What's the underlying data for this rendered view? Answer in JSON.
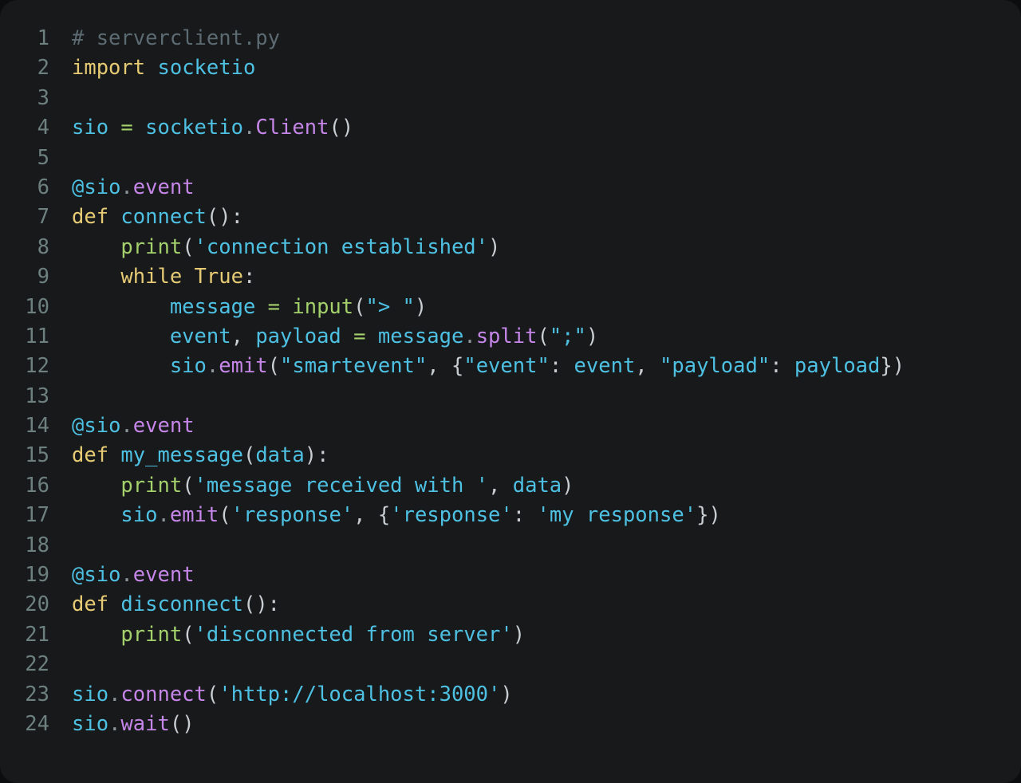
{
  "editor": {
    "filename": "serverclient.py",
    "language": "python",
    "theme": "dark",
    "background_color": "#17191b",
    "page_background_color": "#0b0d0e",
    "gutter_color": "#6d807e",
    "default_text_color": "#d6dadd",
    "first_line_number": 1,
    "last_line_number": 24,
    "total_lines": 24
  },
  "palette": {
    "comment": "#5c6a72",
    "keyword": "#e6cb74",
    "identifier": "#4ec1e3",
    "string": "#4ec1e3",
    "function": "#a4d16b",
    "attribute": "#c586e8",
    "class": "#c586e8",
    "operator": "#a4d16b",
    "punctuation": "#c9ced2"
  },
  "code": {
    "lines": [
      {
        "n": "1",
        "text": "# serverclient.py"
      },
      {
        "n": "2",
        "text": "import socketio"
      },
      {
        "n": "3",
        "text": ""
      },
      {
        "n": "4",
        "text": "sio = socketio.Client()"
      },
      {
        "n": "5",
        "text": ""
      },
      {
        "n": "6",
        "text": "@sio.event"
      },
      {
        "n": "7",
        "text": "def connect():"
      },
      {
        "n": "8",
        "text": "    print('connection established')"
      },
      {
        "n": "9",
        "text": "    while True:"
      },
      {
        "n": "10",
        "text": "        message = input(\"> \")"
      },
      {
        "n": "11",
        "text": "        event, payload = message.split(\";\")"
      },
      {
        "n": "12",
        "text": "        sio.emit(\"smartevent\", {\"event\": event, \"payload\": payload})"
      },
      {
        "n": "13",
        "text": ""
      },
      {
        "n": "14",
        "text": "@sio.event"
      },
      {
        "n": "15",
        "text": "def my_message(data):"
      },
      {
        "n": "16",
        "text": "    print('message received with ', data)"
      },
      {
        "n": "17",
        "text": "    sio.emit('response', {'response': 'my response'})"
      },
      {
        "n": "18",
        "text": ""
      },
      {
        "n": "19",
        "text": "@sio.event"
      },
      {
        "n": "20",
        "text": "def disconnect():"
      },
      {
        "n": "21",
        "text": "    print('disconnected from server')"
      },
      {
        "n": "22",
        "text": ""
      },
      {
        "n": "23",
        "text": "sio.connect('http://localhost:3000')"
      },
      {
        "n": "24",
        "text": "sio.wait()"
      }
    ]
  }
}
